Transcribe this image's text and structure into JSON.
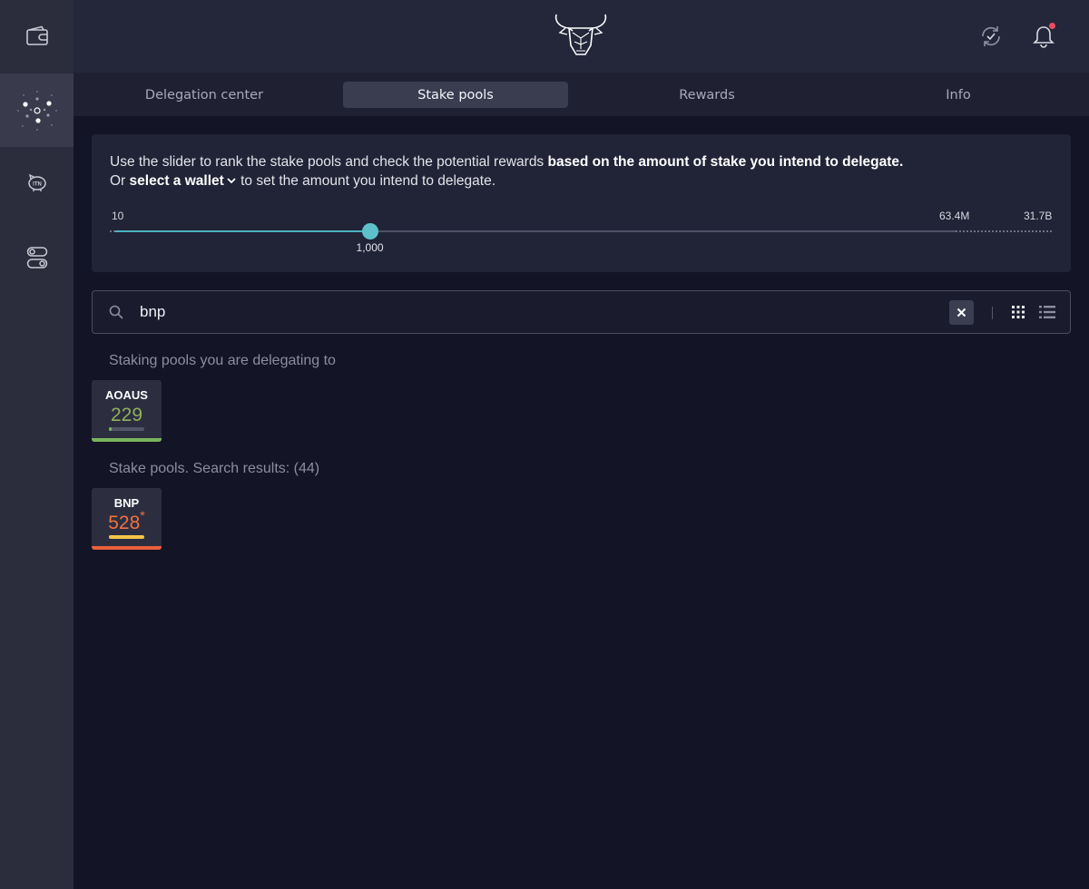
{
  "sidebar": {
    "items": [
      {
        "icon": "wallet-icon",
        "active": false
      },
      {
        "icon": "delegation-network-icon",
        "active": true
      },
      {
        "icon": "itn-piggy-icon",
        "active": false
      },
      {
        "icon": "settings-toggle-icon",
        "active": false
      }
    ]
  },
  "topbar": {
    "logo": "daedalus-bull-logo",
    "sync_icon": "sync-icon",
    "notification_icon": "bell-icon",
    "colors": {
      "notification_dot": "#ea4c5b"
    }
  },
  "tabs": [
    {
      "label": "Delegation center",
      "active": false
    },
    {
      "label": "Stake pools",
      "active": true
    },
    {
      "label": "Rewards",
      "active": false
    },
    {
      "label": "Info",
      "active": false
    }
  ],
  "slider_panel": {
    "text_line1_normal": "Use the slider to rank the stake pools and check the potential rewards ",
    "text_line1_bold": "based on the amount of stake you intend to delegate.",
    "text_line2_prefix": "Or ",
    "text_line2_link": "select a wallet",
    "text_line2_suffix": " to set the amount you intend to delegate.",
    "min_label": "10",
    "mid_label": "63.4M",
    "max_label": "31.7B",
    "value_label": "1,000",
    "thumb_fraction": 0.303,
    "colors": {
      "accent": "#5ec0c8"
    }
  },
  "search": {
    "value": "bnp",
    "placeholder": "Search stake pools"
  },
  "delegating": {
    "title": "Staking pools you are delegating to",
    "pools": [
      {
        "ticker": "AOAUS",
        "rank": "229",
        "asterisk": "",
        "rank_color": "#8fb15a",
        "bar_fill": 0.08,
        "bar_color": "#7bb45a",
        "strip_color": "#7bb45a"
      }
    ]
  },
  "results": {
    "title": "Stake pools. Search results: (44)",
    "pools": [
      {
        "ticker": "BNP",
        "rank": "528",
        "asterisk": "*",
        "rank_color": "#f0713f",
        "bar_fill": 1.0,
        "bar_color": "#f3c44a",
        "strip_color": "#ec5f3b"
      }
    ]
  }
}
